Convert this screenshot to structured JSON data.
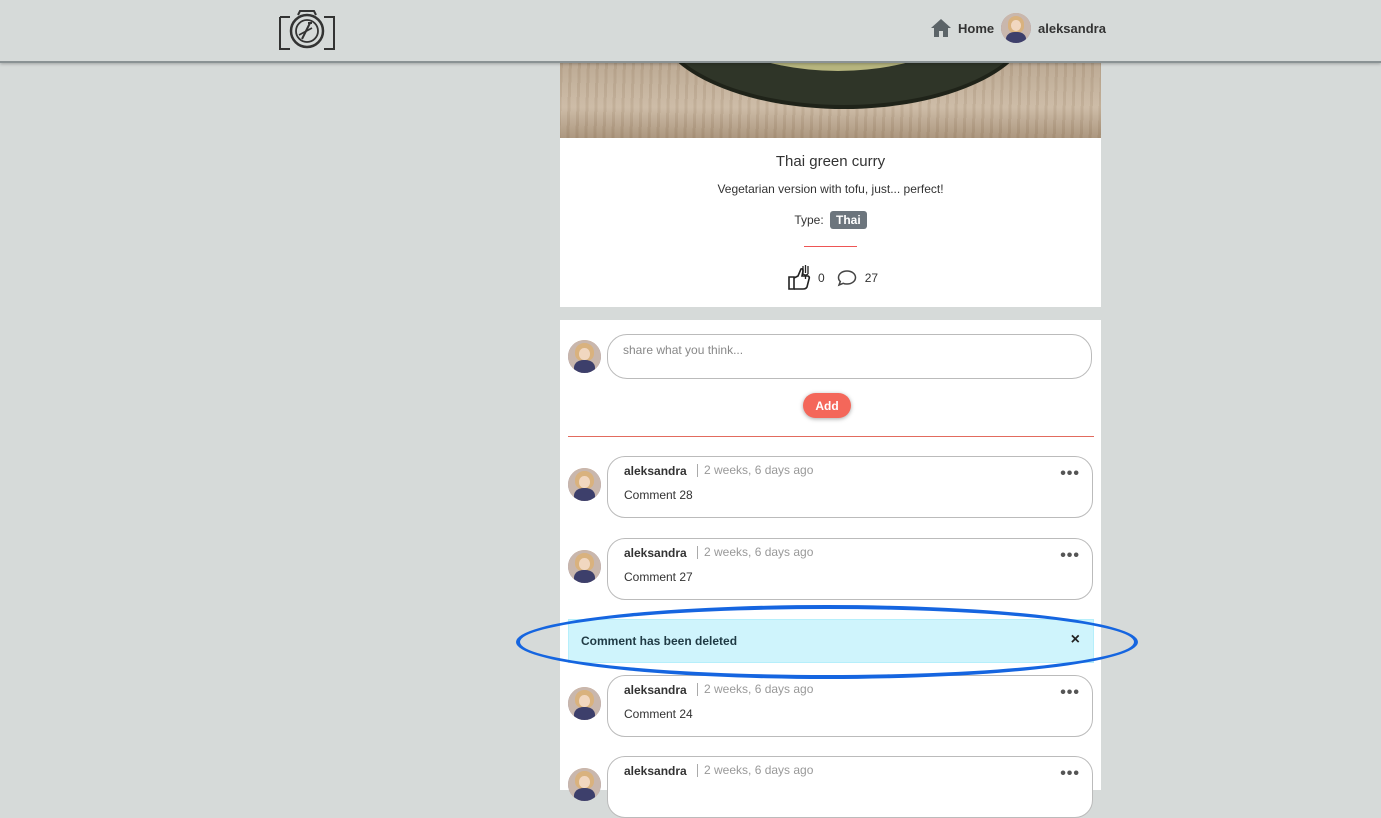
{
  "navbar": {
    "logo_icon": "camera-plate-icon",
    "home_label": "Home",
    "home_icon": "home-icon",
    "user_name": "aleksandra"
  },
  "post": {
    "title": "Thai green curry",
    "description": "Vegetarian version with tofu, just... perfect!",
    "type_label": "Type:",
    "type_value": "Thai",
    "likes": "0",
    "comments_count": "27",
    "like_icon": "thumbs-up-fork-icon",
    "comment_icon": "speech-bubble-icon"
  },
  "comment_form": {
    "placeholder": "share what you think...",
    "add_label": "Add"
  },
  "comments": [
    {
      "author": "aleksandra",
      "time": "2 weeks, 6 days ago",
      "text": "Comment 28"
    },
    {
      "author": "aleksandra",
      "time": "2 weeks, 6 days ago",
      "text": "Comment 27"
    },
    {
      "author": "aleksandra",
      "time": "2 weeks, 6 days ago",
      "text": "Comment 24"
    },
    {
      "author": "aleksandra",
      "time": "2 weeks, 6 days ago",
      "text": ""
    }
  ],
  "alert": {
    "message": "Comment has been deleted",
    "close_symbol": "×"
  },
  "colors": {
    "background": "#d6dad9",
    "accent": "#f4675a",
    "alert_bg": "#cff4fc",
    "highlight": "#1565e0",
    "badge": "#6c757d"
  }
}
